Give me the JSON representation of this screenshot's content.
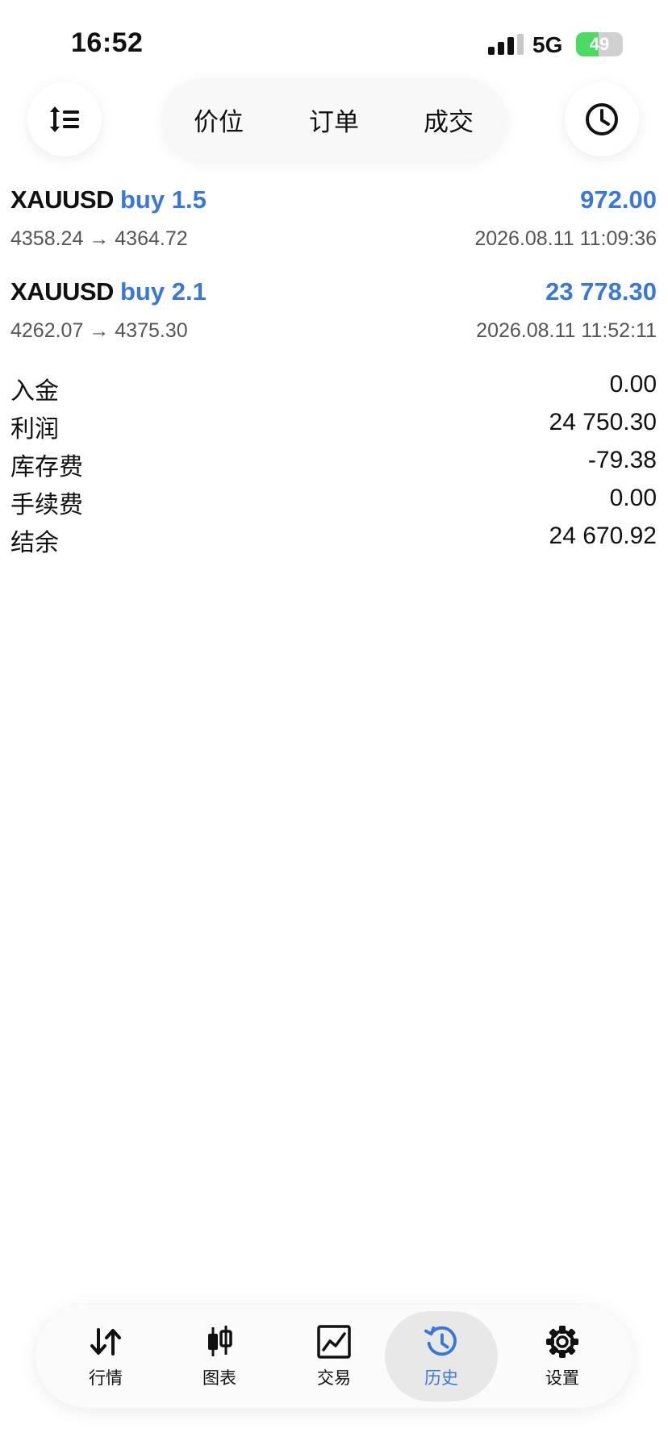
{
  "status_bar": {
    "time": "16:52",
    "network": "5G",
    "battery": "49",
    "battery_level": 0.49,
    "signal_bars_active": 3
  },
  "top_bar": {
    "sort_icon": "sort-lines-icon",
    "history_icon": "clock-icon",
    "segments": [
      {
        "label": "价位",
        "active": true
      },
      {
        "label": "订单",
        "active": false
      },
      {
        "label": "成交",
        "active": false
      }
    ]
  },
  "deals": [
    {
      "symbol": "XAUUSD",
      "side": "buy 1.5",
      "profit": "972.00",
      "prices": "4358.24 → 4364.72",
      "time": "2026.08.11 11:09:36"
    },
    {
      "symbol": "XAUUSD",
      "side": "buy 2.1",
      "profit": "23 778.30",
      "prices": "4262.07 → 4375.30",
      "time": "2026.08.11 11:52:11"
    }
  ],
  "summary": [
    {
      "label": "入金",
      "value": "0.00"
    },
    {
      "label": "利润",
      "value": "24 750.30"
    },
    {
      "label": "库存费",
      "value": "-79.38"
    },
    {
      "label": "手续费",
      "value": "0.00"
    },
    {
      "label": "结余",
      "value": "24 670.92"
    }
  ],
  "tabbar": {
    "tabs": [
      {
        "label": "行情",
        "icon": "quotes-arrows-icon",
        "active": false
      },
      {
        "label": "图表",
        "icon": "candlestick-icon",
        "active": false
      },
      {
        "label": "交易",
        "icon": "trade-chart-icon",
        "active": false
      },
      {
        "label": "历史",
        "icon": "history-icon",
        "active": true
      },
      {
        "label": "设置",
        "icon": "gear-icon",
        "active": false
      }
    ]
  },
  "colors": {
    "accent": "#3a78d8",
    "text": "#111111",
    "secondary_text": "#555555",
    "battery_green": "#4cd964"
  }
}
